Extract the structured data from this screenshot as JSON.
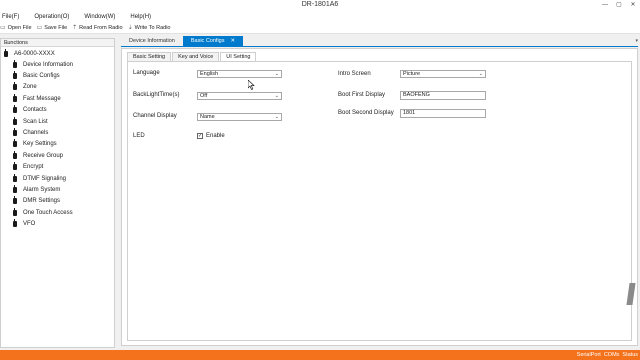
{
  "window": {
    "title": "DR-1801A6",
    "controls": [
      "—",
      "▢",
      "✕"
    ]
  },
  "menu": [
    {
      "label": "File(F)"
    },
    {
      "label": "Operation(O)"
    },
    {
      "label": "Window(W)"
    },
    {
      "label": "Help(H)"
    }
  ],
  "toolbar": {
    "open": "Open File",
    "save": "Save File",
    "read": "Read From Radio",
    "write": "Write To Radio"
  },
  "functions_panel": {
    "title": "Functions",
    "root": "A6-0000-XXXX",
    "items": [
      "Device Information",
      "Basic Configs",
      "Zone",
      "Fast Message",
      "Contacts",
      "Scan List",
      "Channels",
      "Key Settings",
      "Receive Group",
      "Encrypt",
      "DTMF Signaling",
      "Alarm System",
      "DMR Settings",
      "One Touch Access",
      "VFO"
    ]
  },
  "doc_tabs": [
    {
      "label": "Device Information"
    },
    {
      "label": "Basic Configs",
      "close": "✕"
    }
  ],
  "inner_tabs": [
    "Basic Setting",
    "Key and Voice",
    "UI Setting"
  ],
  "ui_setting": {
    "language_label": "Language",
    "language_value": "English",
    "backlight_label": "BackLightTime(s)",
    "backlight_value": "Off",
    "channel_display_label": "Channel Display",
    "channel_display_value": "Name",
    "led_label": "LED",
    "led_enable": "Enable",
    "intro_label": "Intro Screen",
    "intro_value": "Picture",
    "boot_first_label": "Boot First Display",
    "boot_first_value": "BAOFENG",
    "boot_second_label": "Boot Second Display",
    "boot_second_value": "1801"
  },
  "status": {
    "port": "SerialPort",
    "com": "COMx",
    "state": "Status"
  }
}
